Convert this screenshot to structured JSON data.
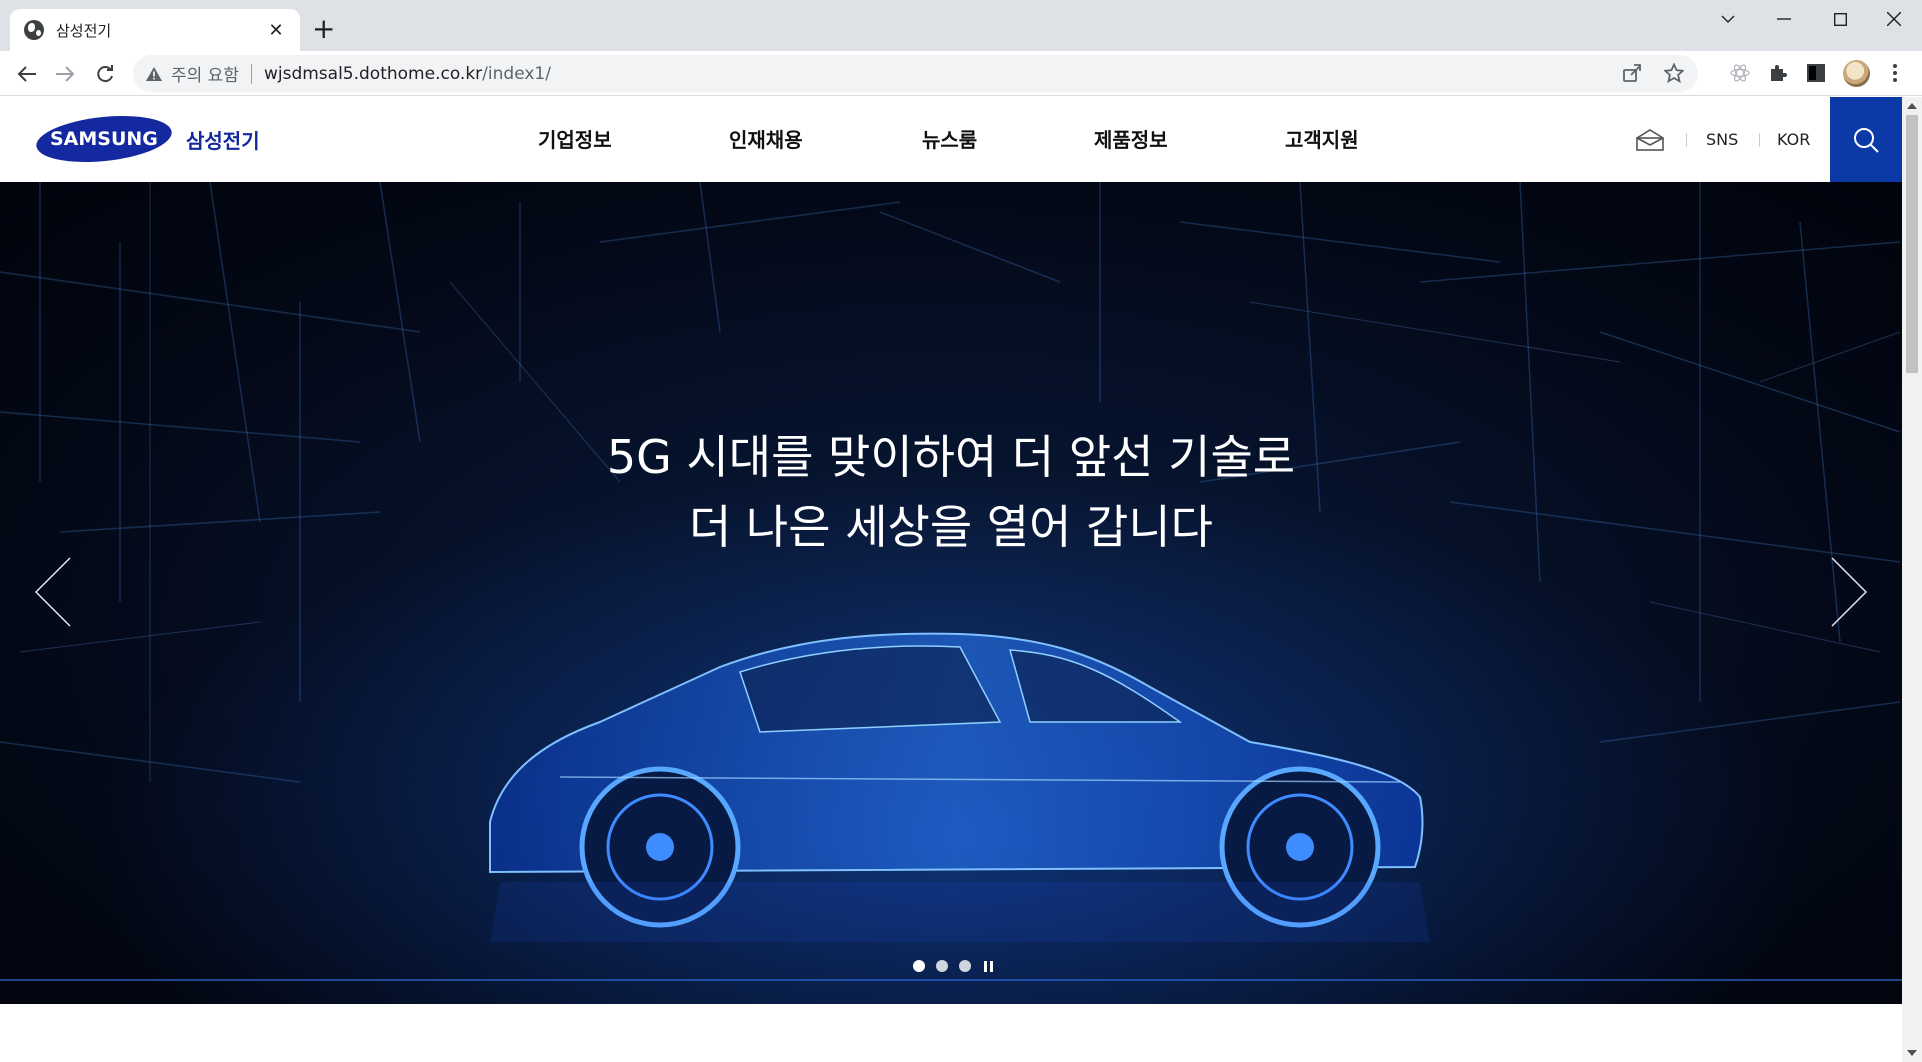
{
  "browser": {
    "tab_title": "삼성전기",
    "tab_close": "✕",
    "new_tab": "+",
    "security_label": "주의 요함",
    "url_host": "wjsdmsal5.dothome.co.kr",
    "url_path": "/index1/"
  },
  "site": {
    "logo_text": "SAMSUNG",
    "logo_kor": "삼성전기",
    "nav": [
      "기업정보",
      "인재채용",
      "뉴스룸",
      "제품정보",
      "고객지원"
    ],
    "util_sns": "SNS",
    "util_lang": "KOR"
  },
  "hero": {
    "title_line1": "5G 시대를 맞이하여 더 앞선 기술로",
    "title_line2": "더 나은 세상을 열어 갑니다",
    "slide_count": 3,
    "active_slide": 1
  },
  "colors": {
    "brand_blue": "#1428a0",
    "search_blue": "#0b3aa6",
    "hero_bg": "#030816"
  }
}
